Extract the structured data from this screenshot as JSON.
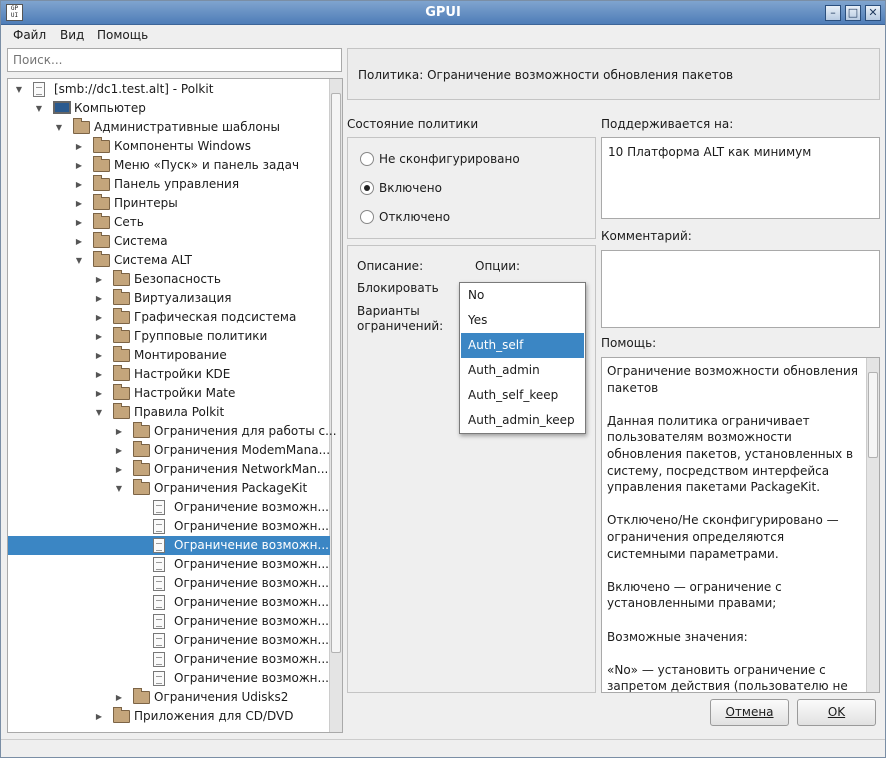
{
  "window": {
    "title": "GPUI",
    "icon_text": "GP UI"
  },
  "menu": {
    "file": "Файл",
    "view": "Вид",
    "help": "Помощь"
  },
  "search": {
    "placeholder": "Поиск..."
  },
  "tree": {
    "rows": [
      {
        "label": "[smb://dc1.test.alt] - Polkit",
        "icon": "document-icon",
        "arrow": "down"
      },
      {
        "label": "Компьютер",
        "icon": "computer-icon",
        "arrow": "down"
      },
      {
        "label": "Административные шаблоны",
        "icon": "folder-icon",
        "arrow": "down"
      },
      {
        "label": "Компоненты Windows",
        "icon": "folder-icon",
        "arrow": "right"
      },
      {
        "label": "Меню «Пуск» и панель задач",
        "icon": "folder-icon",
        "arrow": "right"
      },
      {
        "label": "Панель управления",
        "icon": "folder-icon",
        "arrow": "right"
      },
      {
        "label": "Принтеры",
        "icon": "folder-icon",
        "arrow": "right"
      },
      {
        "label": "Сеть",
        "icon": "folder-icon",
        "arrow": "right"
      },
      {
        "label": "Система",
        "icon": "folder-icon",
        "arrow": "right"
      },
      {
        "label": "Система ALT",
        "icon": "folder-icon",
        "arrow": "down"
      },
      {
        "label": "Безопасность",
        "icon": "folder-icon",
        "arrow": "right"
      },
      {
        "label": "Виртуализация",
        "icon": "folder-icon",
        "arrow": "right"
      },
      {
        "label": "Графическая подсистема",
        "icon": "folder-icon",
        "arrow": "right"
      },
      {
        "label": "Групповые политики",
        "icon": "folder-icon",
        "arrow": "right"
      },
      {
        "label": "Монтирование",
        "icon": "folder-icon",
        "arrow": "right"
      },
      {
        "label": "Настройки KDE",
        "icon": "folder-icon",
        "arrow": "right"
      },
      {
        "label": "Настройки Mate",
        "icon": "folder-icon",
        "arrow": "right"
      },
      {
        "label": "Правила Polkit",
        "icon": "folder-icon",
        "arrow": "down"
      },
      {
        "label": "Ограничения для работы с...",
        "icon": "folder-icon",
        "arrow": "right"
      },
      {
        "label": "Ограничения ModemMana...",
        "icon": "folder-icon",
        "arrow": "right"
      },
      {
        "label": "Ограничения NetworkMan...",
        "icon": "folder-icon",
        "arrow": "right"
      },
      {
        "label": "Ограничения PackageKit",
        "icon": "folder-icon",
        "arrow": "down"
      },
      {
        "label": "Ограничение возможн...",
        "icon": "document-icon",
        "arrow": ""
      },
      {
        "label": "Ограничение возможн...",
        "icon": "document-icon",
        "arrow": ""
      },
      {
        "label": "Ограничение возможн...",
        "icon": "document-icon",
        "arrow": ""
      },
      {
        "label": "Ограничение возможн...",
        "icon": "document-icon",
        "arrow": ""
      },
      {
        "label": "Ограничение возможн...",
        "icon": "document-icon",
        "arrow": ""
      },
      {
        "label": "Ограничение возможн...",
        "icon": "document-icon",
        "arrow": ""
      },
      {
        "label": "Ограничение возможн...",
        "icon": "document-icon",
        "arrow": ""
      },
      {
        "label": "Ограничение возможн...",
        "icon": "document-icon",
        "arrow": ""
      },
      {
        "label": "Ограничение возможн...",
        "icon": "document-icon",
        "arrow": ""
      },
      {
        "label": "Ограничение возможн...",
        "icon": "document-icon",
        "arrow": ""
      },
      {
        "label": "Ограничения Udisks2",
        "icon": "folder-icon",
        "arrow": "right"
      },
      {
        "label": "Приложения для CD/DVD",
        "icon": "folder-icon",
        "arrow": "right"
      }
    ],
    "selected_row": 24
  },
  "policy": {
    "title": "Политика: Ограничение возможности обновления пакетов"
  },
  "state": {
    "heading": "Состояние политики",
    "options": [
      "Не сконфигурировано",
      "Включено",
      "Отключено"
    ],
    "selected": "Включено"
  },
  "supported": {
    "heading": "Поддерживается на:",
    "value": "10 Платформа ALT как минимум"
  },
  "comment": {
    "heading": "Комментарий:",
    "value": ""
  },
  "options": {
    "description_label": "Описание:",
    "options_label": "Опции:",
    "block_label": "Блокировать",
    "variants_label": "Варианты ограничений:"
  },
  "dropdown": {
    "items": [
      "No",
      "Yes",
      "Auth_self",
      "Auth_admin",
      "Auth_self_keep",
      "Auth_admin_keep"
    ],
    "selected": "Auth_self"
  },
  "help": {
    "heading": "Помощь:",
    "text": "Ограничение возможности обновления пакетов\n\nДанная политика ограничивает пользователям возможности обновления пакетов, установленных в систему, посредством интерфейса управления пакетами PackageKit.\n\nОтключено/Не сконфигурировано — ограничения определяются системными параметрами.\n\nВключено — ограничение с установленными правами;\n\nВозможные значения:\n\n«No» — установить ограничение с запретом действия (пользователю не"
  },
  "buttons": {
    "cancel": "Отмена",
    "ok": "OK"
  },
  "colors": {
    "selection": "#3b86c4",
    "titlebar": "#5f89bf"
  }
}
